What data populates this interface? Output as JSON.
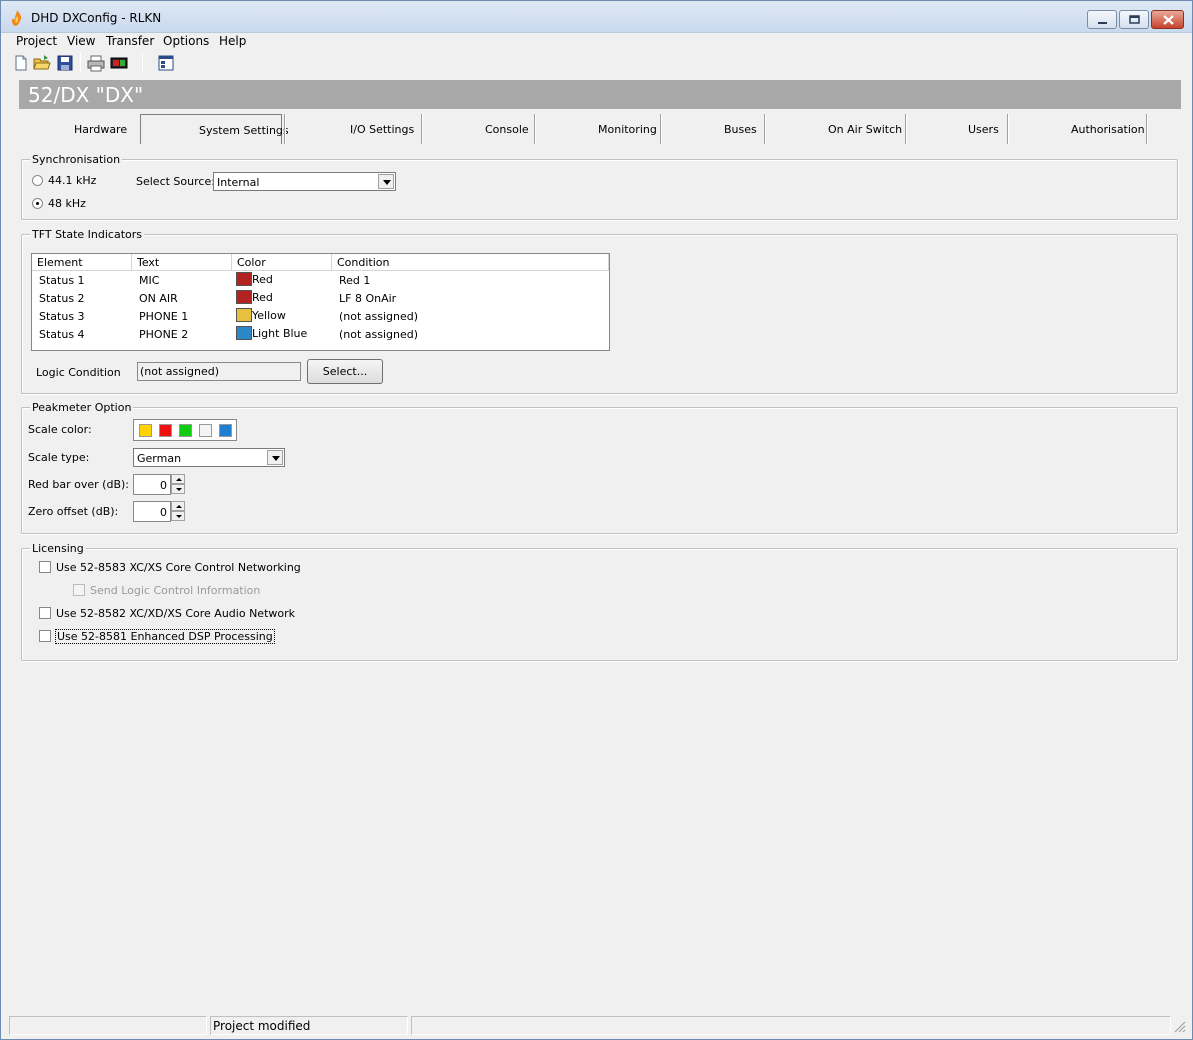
{
  "window": {
    "title": "DHD DXConfig - RLKN"
  },
  "menu": [
    "Project",
    "View",
    "Transfer",
    "Options",
    "Help"
  ],
  "toolbar": {
    "icons": [
      "new-file-icon",
      "open-folder-icon",
      "save-icon",
      "print-icon",
      "device-icon",
      "properties-icon"
    ]
  },
  "banner": {
    "title": "52/DX \"DX\""
  },
  "tabs": [
    {
      "label": "Hardware"
    },
    {
      "label": "System Settings",
      "active": true
    },
    {
      "label": "I/O Settings"
    },
    {
      "label": "Console"
    },
    {
      "label": "Monitoring"
    },
    {
      "label": "Buses"
    },
    {
      "label": "On Air Switch"
    },
    {
      "label": "Users"
    },
    {
      "label": "Authorisation"
    }
  ],
  "sync": {
    "title": "Synchronisation",
    "opt1": "44.1 kHz",
    "opt2": "48 kHz",
    "selected": "48 kHz",
    "source_label": "Select Source:",
    "source_value": "Internal"
  },
  "tft": {
    "title": "TFT State Indicators",
    "columns": [
      "Element",
      "Text",
      "Color",
      "Condition"
    ],
    "rows": [
      {
        "element": "Status 1",
        "text": "MIC",
        "color": "Red",
        "color_hex": "#b22222",
        "condition": "Red 1"
      },
      {
        "element": "Status 2",
        "text": "ON AIR",
        "color": "Red",
        "color_hex": "#b22222",
        "condition": "LF 8 OnAir"
      },
      {
        "element": "Status 3",
        "text": "PHONE 1",
        "color": "Yellow",
        "color_hex": "#e8c040",
        "condition": "(not assigned)"
      },
      {
        "element": "Status 4",
        "text": "PHONE 2",
        "color": "Light Blue",
        "color_hex": "#2c87c8",
        "condition": "(not assigned)"
      }
    ],
    "logic_label": "Logic Condition",
    "logic_value": "(not assigned)",
    "select_button": "Select..."
  },
  "peak": {
    "title": "Peakmeter Option",
    "scale_color_label": "Scale color:",
    "scale_colors": [
      "#ffd400",
      "#ee1111",
      "#11cc11",
      "#f4f4f4",
      "#1e7fd0"
    ],
    "scale_type_label": "Scale type:",
    "scale_type_value": "German",
    "red_bar_label": "Red bar over (dB):",
    "red_bar_value": "0",
    "zero_offset_label": "Zero offset (dB):",
    "zero_offset_value": "0"
  },
  "licensing": {
    "title": "Licensing",
    "opt1": "Use 52-8583 XC/XS Core Control Networking",
    "opt1_sub": "Send Logic Control Information",
    "opt2": "Use 52-8582 XC/XD/XS Core Audio Network",
    "opt3": "Use 52-8581 Enhanced DSP Processing"
  },
  "status": {
    "pane2": "Project modified"
  }
}
